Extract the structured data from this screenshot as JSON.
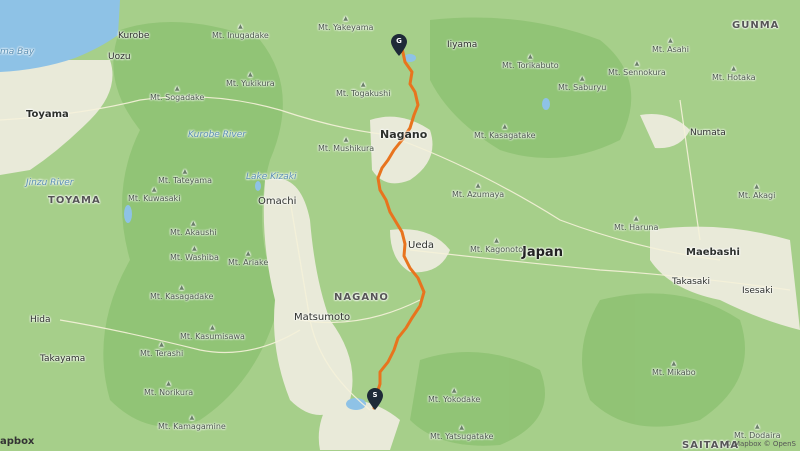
{
  "map": {
    "water": {
      "bay": "ma Bay",
      "rivers": [
        "Kurobe River",
        "Jinzu River"
      ],
      "lakes": [
        "Lake Kizaki"
      ]
    },
    "cities": {
      "kurobe": "Kurobe",
      "uozu": "Uozu",
      "toyama": "Toyama",
      "omachi": "Omachi",
      "matsumoto": "Matsumoto",
      "hida": "Hida",
      "takayama": "Takayama",
      "iiyama": "Iiyama",
      "nagano": "Nagano",
      "ueda": "Ueda",
      "numata": "Numata",
      "maebashi": "Maebashi",
      "takasaki": "Takasaki",
      "isesaki": "Isesaki"
    },
    "country": "Japan",
    "regions": {
      "toyama": "TOYAMA",
      "nagano": "NAGANO",
      "gunma": "GUNMA",
      "saitama": "SAITAMA"
    },
    "peaks": {
      "yakeyama": "Mt. Yakeyama",
      "inugadake": "Mt. Inugadake",
      "sogadake": "Mt. Sogadake",
      "yukikura": "Mt. Yukikura",
      "togakushi": "Mt. Togakushi",
      "mushikura": "Mt. Mushikura",
      "tateyama": "Mt. Tateyama",
      "kuwasaki": "Mt. Kuwasaki",
      "akaushi": "Mt. Akaushi",
      "washiba": "Mt. Washiba",
      "ariake": "Mt. Ariake",
      "kasagadake": "Mt. Kasagadake",
      "kasumisawa": "Mt. Kasumisawa",
      "terashi": "Mt. Terashi",
      "norikura": "Mt. Norikura",
      "kamagamine": "Mt. Kamagamine",
      "torikabuto": "Mt. Torikabuto",
      "senkokura": "Mt. Sennokura",
      "saburyu": "Mt. Saburyu",
      "asahi": "Mt. Asahi",
      "hotaka": "Mt. Hotaka",
      "kasagatake": "Mt. Kasagatake",
      "azumaya": "Mt. Azumaya",
      "kagonoto": "Mt. Kagonoto",
      "haruna": "Mt. Haruna",
      "akagi": "Mt. Akagi",
      "mikabo": "Mt. Mikabo",
      "yokodake": "Mt. Yokodake",
      "yatsugatake": "Mt. Yatsugatake",
      "dodaira": "Mt. Dodaira"
    },
    "markers": {
      "goal": "G",
      "start": "S"
    },
    "attribution": "© Mapbox © OpenS",
    "logo": "apbox",
    "colors": {
      "route": "#e8741e",
      "terrain": "#a6cf8a",
      "valley": "#e9ead9",
      "sea": "#8ec2e6",
      "marker": "#1e2a38"
    }
  }
}
